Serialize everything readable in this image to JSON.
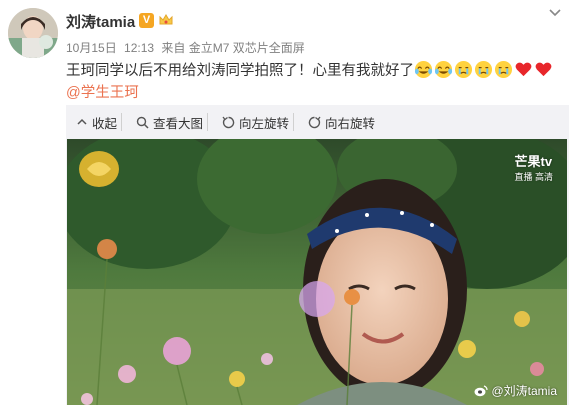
{
  "post": {
    "username": "刘涛tamia",
    "verified_badge": "V",
    "date": "10月15日",
    "time": "12:13",
    "source": "来自 金立M7 双芯片全面屏",
    "text": "王珂同学以后不用给刘涛同学拍照了！心里有我就好了",
    "mention": "@学生王珂"
  },
  "toolbar": {
    "collapse": "收起",
    "view_full": "查看大图",
    "rotate_left": "向左旋转",
    "rotate_right": "向右旋转"
  },
  "photo": {
    "watermark": "@刘涛tamia",
    "channel_logo": "芒果tv",
    "channel_sub": "直播 高清"
  },
  "colors": {
    "accent": "#eb7350",
    "badge": "#f5a623",
    "toolbar_bg": "#f2f2f5"
  },
  "icons": [
    "v-badge-icon",
    "crown-icon",
    "chevron-down-icon",
    "collapse-icon",
    "search-icon",
    "rotate-left-icon",
    "rotate-right-icon",
    "weibo-icon",
    "laugh-cry-emoji",
    "tear-emoji",
    "heart-emoji",
    "mango-logo-icon"
  ]
}
